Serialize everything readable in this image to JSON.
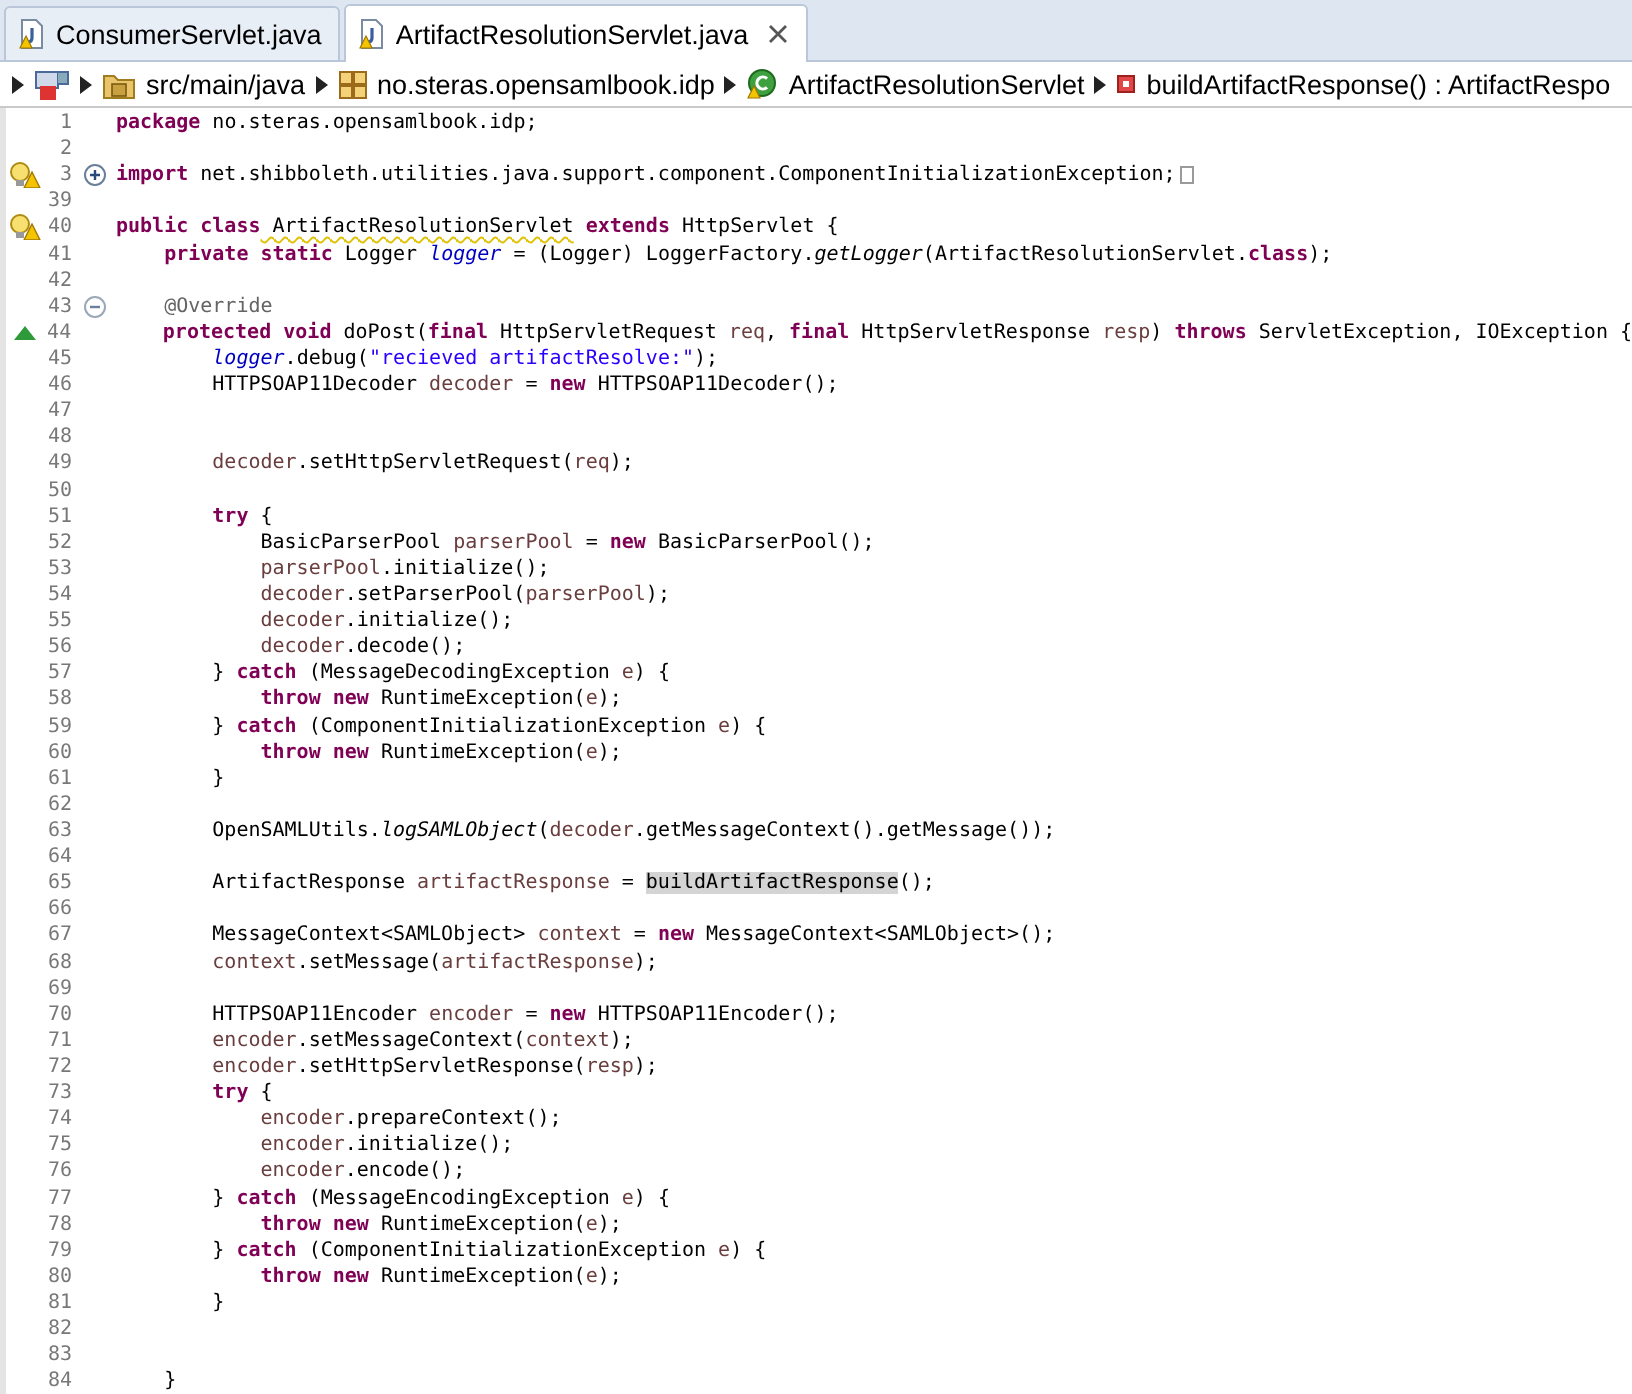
{
  "tabs": [
    {
      "label": "ConsumerServlet.java",
      "selected": false
    },
    {
      "label": "ArtifactResolutionServlet.java",
      "selected": true
    }
  ],
  "breadcrumb": [
    {
      "kind": "project"
    },
    {
      "kind": "source-folder",
      "label": "src/main/java"
    },
    {
      "kind": "package",
      "label": "no.steras.opensamlbook.idp"
    },
    {
      "kind": "class",
      "label": "ArtifactResolutionServlet"
    },
    {
      "kind": "method",
      "label": "buildArtifactResponse() : ArtifactRespo"
    }
  ],
  "lines": [
    {
      "number": "1",
      "tokens": [
        {
          "kind": "keyword",
          "text": "package"
        },
        {
          "kind": "plain",
          "text": " no.steras.opensamlbook.idp;"
        }
      ]
    },
    {
      "number": "2"
    },
    {
      "number": "3",
      "warning": true,
      "expanded": false,
      "tokens": [
        {
          "kind": "keyword",
          "text": "import"
        },
        {
          "kind": "plain",
          "text": " net.shibboleth.utilities.java.support.component.ComponentInitializationException;"
        }
      ]
    },
    {
      "number": "39"
    },
    {
      "number": "40",
      "warning": true,
      "tokens": [
        {
          "kind": "keyword",
          "text": "public"
        },
        {
          "kind": "keyword",
          "text": " class"
        },
        {
          "kind": "warned",
          "text": " ArtifactResolutionServlet"
        },
        {
          "kind": "keyword",
          "text": " extends"
        },
        {
          "kind": "plain",
          "text": " HttpServlet {"
        }
      ]
    },
    {
      "number": "41",
      "tokens": [
        {
          "kind": "keyword",
          "text": "    private"
        },
        {
          "kind": "keyword",
          "text": " static"
        },
        {
          "kind": "plain",
          "text": " Logger "
        },
        {
          "kind": "static-field",
          "text": "logger"
        },
        {
          "kind": "plain",
          "text": " = (Logger) LoggerFactory."
        },
        {
          "kind": "static-method",
          "text": "getLogger"
        },
        {
          "kind": "plain",
          "text": "(ArtifactResolutionServlet."
        },
        {
          "kind": "keyword",
          "text": "class"
        },
        {
          "kind": "plain",
          "text": ");"
        }
      ]
    },
    {
      "number": "42"
    },
    {
      "number": "43",
      "expanded": true,
      "tokens": [
        {
          "kind": "annotation",
          "text": "    @Override"
        }
      ]
    },
    {
      "number": "44",
      "overrides": true,
      "tokens": [
        {
          "kind": "keyword",
          "text": "    protected"
        },
        {
          "kind": "keyword",
          "text": " void"
        },
        {
          "kind": "plain",
          "text": " doPost("
        },
        {
          "kind": "keyword",
          "text": "final"
        },
        {
          "kind": "plain",
          "text": " HttpServletRequest "
        },
        {
          "kind": "local",
          "text": "req"
        },
        {
          "kind": "plain",
          "text": ", "
        },
        {
          "kind": "keyword",
          "text": "final"
        },
        {
          "kind": "plain",
          "text": " HttpServletResponse "
        },
        {
          "kind": "local",
          "text": "resp"
        },
        {
          "kind": "plain",
          "text": ") "
        },
        {
          "kind": "keyword",
          "text": "throws"
        },
        {
          "kind": "plain",
          "text": " ServletException, IOException {"
        }
      ]
    },
    {
      "number": "45",
      "tokens": [
        {
          "kind": "static-field",
          "text": "        logger"
        },
        {
          "kind": "plain",
          "text": ".debug("
        },
        {
          "kind": "string",
          "text": "\"recieved artifactResolve:\""
        },
        {
          "kind": "plain",
          "text": ");"
        }
      ]
    },
    {
      "number": "46",
      "tokens": [
        {
          "kind": "plain",
          "text": "        HTTPSOAP11Decoder "
        },
        {
          "kind": "local",
          "text": "decoder"
        },
        {
          "kind": "plain",
          "text": " = "
        },
        {
          "kind": "keyword",
          "text": "new"
        },
        {
          "kind": "plain",
          "text": " HTTPSOAP11Decoder();"
        }
      ]
    },
    {
      "number": "47"
    },
    {
      "number": "48"
    },
    {
      "number": "49",
      "tokens": [
        {
          "kind": "local",
          "text": "        decoder"
        },
        {
          "kind": "plain",
          "text": ".setHttpServletRequest("
        },
        {
          "kind": "local",
          "text": "req"
        },
        {
          "kind": "plain",
          "text": ");"
        }
      ]
    },
    {
      "number": "50"
    },
    {
      "number": "51",
      "tokens": [
        {
          "kind": "keyword",
          "text": "        try"
        },
        {
          "kind": "plain",
          "text": " {"
        }
      ]
    },
    {
      "number": "52",
      "tokens": [
        {
          "kind": "plain",
          "text": "            BasicParserPool "
        },
        {
          "kind": "local",
          "text": "parserPool"
        },
        {
          "kind": "plain",
          "text": " = "
        },
        {
          "kind": "keyword",
          "text": "new"
        },
        {
          "kind": "plain",
          "text": " BasicParserPool();"
        }
      ]
    },
    {
      "number": "53",
      "tokens": [
        {
          "kind": "local",
          "text": "            parserPool"
        },
        {
          "kind": "plain",
          "text": ".initialize();"
        }
      ]
    },
    {
      "number": "54",
      "tokens": [
        {
          "kind": "local",
          "text": "            decoder"
        },
        {
          "kind": "plain",
          "text": ".setParserPool("
        },
        {
          "kind": "local",
          "text": "parserPool"
        },
        {
          "kind": "plain",
          "text": ");"
        }
      ]
    },
    {
      "number": "55",
      "tokens": [
        {
          "kind": "local",
          "text": "            decoder"
        },
        {
          "kind": "plain",
          "text": ".initialize();"
        }
      ]
    },
    {
      "number": "56",
      "tokens": [
        {
          "kind": "local",
          "text": "            decoder"
        },
        {
          "kind": "plain",
          "text": ".decode();"
        }
      ]
    },
    {
      "number": "57",
      "tokens": [
        {
          "kind": "plain",
          "text": "        } "
        },
        {
          "kind": "keyword",
          "text": "catch"
        },
        {
          "kind": "plain",
          "text": " (MessageDecodingException "
        },
        {
          "kind": "local",
          "text": "e"
        },
        {
          "kind": "plain",
          "text": ") {"
        }
      ]
    },
    {
      "number": "58",
      "tokens": [
        {
          "kind": "keyword",
          "text": "            throw"
        },
        {
          "kind": "keyword",
          "text": " new"
        },
        {
          "kind": "plain",
          "text": " RuntimeException("
        },
        {
          "kind": "local",
          "text": "e"
        },
        {
          "kind": "plain",
          "text": ");"
        }
      ]
    },
    {
      "number": "59",
      "tokens": [
        {
          "kind": "plain",
          "text": "        } "
        },
        {
          "kind": "keyword",
          "text": "catch"
        },
        {
          "kind": "plain",
          "text": " (ComponentInitializationException "
        },
        {
          "kind": "local",
          "text": "e"
        },
        {
          "kind": "plain",
          "text": ") {"
        }
      ]
    },
    {
      "number": "60",
      "tokens": [
        {
          "kind": "keyword",
          "text": "            throw"
        },
        {
          "kind": "keyword",
          "text": " new"
        },
        {
          "kind": "plain",
          "text": " RuntimeException("
        },
        {
          "kind": "local",
          "text": "e"
        },
        {
          "kind": "plain",
          "text": ");"
        }
      ]
    },
    {
      "number": "61",
      "tokens": [
        {
          "kind": "plain",
          "text": "        }"
        }
      ]
    },
    {
      "number": "62"
    },
    {
      "number": "63",
      "tokens": [
        {
          "kind": "plain",
          "text": "        OpenSAMLUtils."
        },
        {
          "kind": "static-method",
          "text": "logSAMLObject"
        },
        {
          "kind": "plain",
          "text": "("
        },
        {
          "kind": "local",
          "text": "decoder"
        },
        {
          "kind": "plain",
          "text": ".getMessageContext().getMessage());"
        }
      ]
    },
    {
      "number": "64"
    },
    {
      "number": "65",
      "tokens": [
        {
          "kind": "plain",
          "text": "        ArtifactResponse "
        },
        {
          "kind": "local",
          "text": "artifactResponse"
        },
        {
          "kind": "plain",
          "text": " = "
        },
        {
          "kind": "occurrence",
          "text": "buildArtifactResponse"
        },
        {
          "kind": "plain",
          "text": "();"
        }
      ]
    },
    {
      "number": "66"
    },
    {
      "number": "67",
      "tokens": [
        {
          "kind": "plain",
          "text": "        MessageContext<SAMLObject> "
        },
        {
          "kind": "local",
          "text": "context"
        },
        {
          "kind": "plain",
          "text": " = "
        },
        {
          "kind": "keyword",
          "text": "new"
        },
        {
          "kind": "plain",
          "text": " MessageContext<SAMLObject>();"
        }
      ]
    },
    {
      "number": "68",
      "tokens": [
        {
          "kind": "local",
          "text": "        context"
        },
        {
          "kind": "plain",
          "text": ".setMessage("
        },
        {
          "kind": "local",
          "text": "artifactResponse"
        },
        {
          "kind": "plain",
          "text": ");"
        }
      ]
    },
    {
      "number": "69"
    },
    {
      "number": "70",
      "tokens": [
        {
          "kind": "plain",
          "text": "        HTTPSOAP11Encoder "
        },
        {
          "kind": "local",
          "text": "encoder"
        },
        {
          "kind": "plain",
          "text": " = "
        },
        {
          "kind": "keyword",
          "text": "new"
        },
        {
          "kind": "plain",
          "text": " HTTPSOAP11Encoder();"
        }
      ]
    },
    {
      "number": "71",
      "tokens": [
        {
          "kind": "local",
          "text": "        encoder"
        },
        {
          "kind": "plain",
          "text": ".setMessageContext("
        },
        {
          "kind": "local",
          "text": "context"
        },
        {
          "kind": "plain",
          "text": ");"
        }
      ]
    },
    {
      "number": "72",
      "tokens": [
        {
          "kind": "local",
          "text": "        encoder"
        },
        {
          "kind": "plain",
          "text": ".setHttpServletResponse("
        },
        {
          "kind": "local",
          "text": "resp"
        },
        {
          "kind": "plain",
          "text": ");"
        }
      ]
    },
    {
      "number": "73",
      "tokens": [
        {
          "kind": "keyword",
          "text": "        try"
        },
        {
          "kind": "plain",
          "text": " {"
        }
      ]
    },
    {
      "number": "74",
      "tokens": [
        {
          "kind": "local",
          "text": "            encoder"
        },
        {
          "kind": "plain",
          "text": ".prepareContext();"
        }
      ]
    },
    {
      "number": "75",
      "tokens": [
        {
          "kind": "local",
          "text": "            encoder"
        },
        {
          "kind": "plain",
          "text": ".initialize();"
        }
      ]
    },
    {
      "number": "76",
      "tokens": [
        {
          "kind": "local",
          "text": "            encoder"
        },
        {
          "kind": "plain",
          "text": ".encode();"
        }
      ]
    },
    {
      "number": "77",
      "tokens": [
        {
          "kind": "plain",
          "text": "        } "
        },
        {
          "kind": "keyword",
          "text": "catch"
        },
        {
          "kind": "plain",
          "text": " (MessageEncodingException "
        },
        {
          "kind": "local",
          "text": "e"
        },
        {
          "kind": "plain",
          "text": ") {"
        }
      ]
    },
    {
      "number": "78",
      "tokens": [
        {
          "kind": "keyword",
          "text": "            throw"
        },
        {
          "kind": "keyword",
          "text": " new"
        },
        {
          "kind": "plain",
          "text": " RuntimeException("
        },
        {
          "kind": "local",
          "text": "e"
        },
        {
          "kind": "plain",
          "text": ");"
        }
      ]
    },
    {
      "number": "79",
      "tokens": [
        {
          "kind": "plain",
          "text": "        } "
        },
        {
          "kind": "keyword",
          "text": "catch"
        },
        {
          "kind": "plain",
          "text": " (ComponentInitializationException "
        },
        {
          "kind": "local",
          "text": "e"
        },
        {
          "kind": "plain",
          "text": ") {"
        }
      ]
    },
    {
      "number": "80",
      "tokens": [
        {
          "kind": "keyword",
          "text": "            throw"
        },
        {
          "kind": "keyword",
          "text": " new"
        },
        {
          "kind": "plain",
          "text": " RuntimeException("
        },
        {
          "kind": "local",
          "text": "e"
        },
        {
          "kind": "plain",
          "text": ");"
        }
      ]
    },
    {
      "number": "81",
      "tokens": [
        {
          "kind": "plain",
          "text": "        }"
        }
      ]
    },
    {
      "number": "82"
    },
    {
      "number": "83"
    },
    {
      "number": "84",
      "tokens": [
        {
          "kind": "plain",
          "text": "    }"
        }
      ]
    }
  ]
}
